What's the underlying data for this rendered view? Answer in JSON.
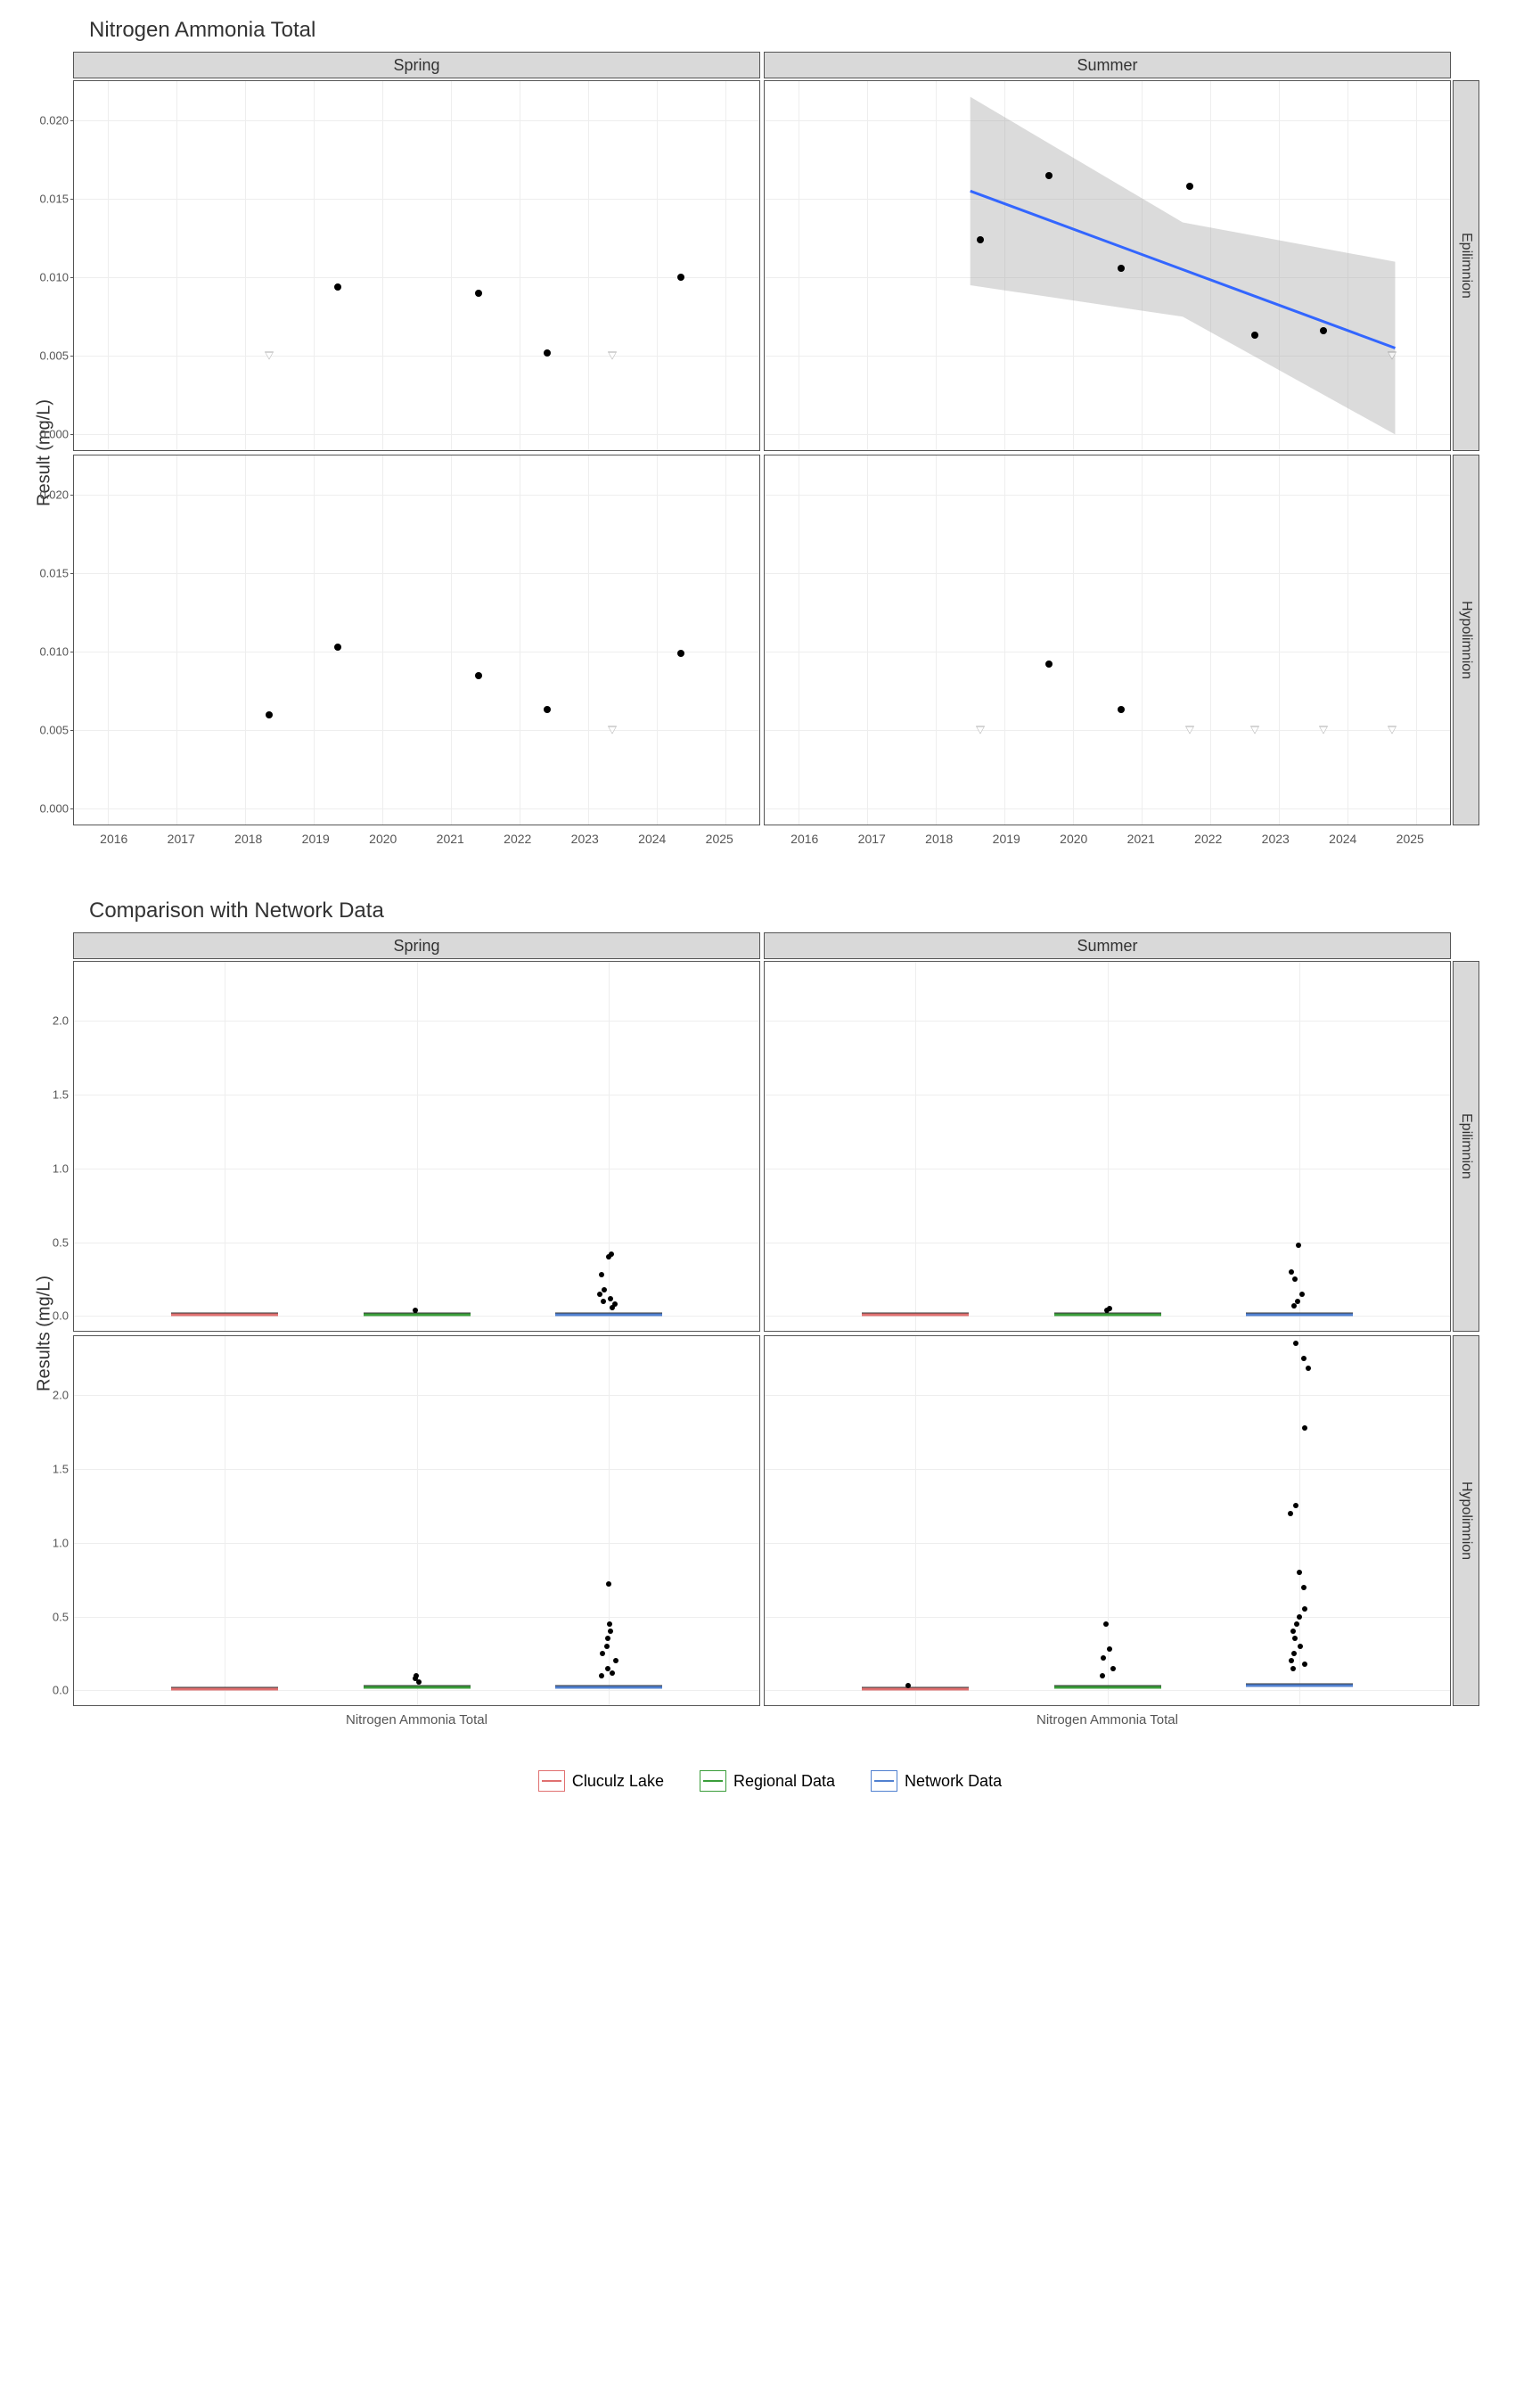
{
  "chart_data": [
    {
      "type": "scatter",
      "title": "Nitrogen Ammonia Total",
      "ylabel": "Result (mg/L)",
      "xlabel": "",
      "x_ticks": [
        "2016",
        "2017",
        "2018",
        "2019",
        "2020",
        "2021",
        "2022",
        "2023",
        "2024",
        "2025"
      ],
      "y_ticks": [
        "0.000",
        "0.005",
        "0.010",
        "0.015",
        "0.020"
      ],
      "xlim": [
        2015.5,
        2025.5
      ],
      "ylim": [
        -0.001,
        0.0225
      ],
      "col_facets": [
        "Spring",
        "Summer"
      ],
      "row_facets": [
        "Epilimnion",
        "Hypolimnion"
      ],
      "panels": {
        "Spring_Epilimnion": {
          "points": [
            {
              "x": 2018.35,
              "y": 0.005,
              "shape": "triangle"
            },
            {
              "x": 2019.35,
              "y": 0.0094,
              "shape": "dot"
            },
            {
              "x": 2021.4,
              "y": 0.009,
              "shape": "dot"
            },
            {
              "x": 2022.4,
              "y": 0.0052,
              "shape": "dot"
            },
            {
              "x": 2023.35,
              "y": 0.005,
              "shape": "triangle"
            },
            {
              "x": 2024.35,
              "y": 0.01,
              "shape": "dot"
            }
          ]
        },
        "Summer_Epilimnion": {
          "points": [
            {
              "x": 2018.65,
              "y": 0.0124,
              "shape": "dot"
            },
            {
              "x": 2019.65,
              "y": 0.0165,
              "shape": "dot"
            },
            {
              "x": 2020.7,
              "y": 0.0106,
              "shape": "dot"
            },
            {
              "x": 2021.7,
              "y": 0.0158,
              "shape": "dot"
            },
            {
              "x": 2022.65,
              "y": 0.0063,
              "shape": "dot"
            },
            {
              "x": 2023.65,
              "y": 0.0066,
              "shape": "dot"
            },
            {
              "x": 2024.65,
              "y": 0.005,
              "shape": "triangle"
            }
          ],
          "trend": {
            "x1": 2018.5,
            "y1": 0.0155,
            "x2": 2024.7,
            "y2": 0.0055
          },
          "ci": [
            {
              "x": 2018.5,
              "lo": 0.0095,
              "hi": 0.0215
            },
            {
              "x": 2021.6,
              "lo": 0.0075,
              "hi": 0.0135
            },
            {
              "x": 2024.7,
              "lo": 0.0,
              "hi": 0.011
            }
          ]
        },
        "Spring_Hypolimnion": {
          "points": [
            {
              "x": 2018.35,
              "y": 0.006,
              "shape": "dot"
            },
            {
              "x": 2019.35,
              "y": 0.0103,
              "shape": "dot"
            },
            {
              "x": 2021.4,
              "y": 0.0085,
              "shape": "dot"
            },
            {
              "x": 2022.4,
              "y": 0.0063,
              "shape": "dot"
            },
            {
              "x": 2023.35,
              "y": 0.005,
              "shape": "triangle"
            },
            {
              "x": 2024.35,
              "y": 0.0099,
              "shape": "dot"
            }
          ]
        },
        "Summer_Hypolimnion": {
          "points": [
            {
              "x": 2018.65,
              "y": 0.005,
              "shape": "triangle"
            },
            {
              "x": 2019.65,
              "y": 0.0092,
              "shape": "dot"
            },
            {
              "x": 2020.7,
              "y": 0.0063,
              "shape": "dot"
            },
            {
              "x": 2021.7,
              "y": 0.005,
              "shape": "triangle"
            },
            {
              "x": 2022.65,
              "y": 0.005,
              "shape": "triangle"
            },
            {
              "x": 2023.65,
              "y": 0.005,
              "shape": "triangle"
            },
            {
              "x": 2024.65,
              "y": 0.005,
              "shape": "triangle"
            }
          ]
        }
      }
    },
    {
      "type": "boxplot",
      "title": "Comparison with Network Data",
      "ylabel": "Results (mg/L)",
      "xlabel": "",
      "x_category": "Nitrogen Ammonia Total",
      "y_ticks": [
        "0.0",
        "0.5",
        "1.0",
        "1.5",
        "2.0"
      ],
      "ylim": [
        -0.1,
        2.4
      ],
      "col_facets": [
        "Spring",
        "Summer"
      ],
      "row_facets": [
        "Epilimnion",
        "Hypolimnion"
      ],
      "groups": [
        "Cluculz Lake",
        "Regional Data",
        "Network Data"
      ],
      "colors": {
        "Cluculz Lake": "#e07070",
        "Regional Data": "#3a9d3a",
        "Network Data": "#5080d0"
      },
      "panels": {
        "Spring_Epilimnion": {
          "boxes": [
            {
              "g": "Cluculz Lake",
              "med": 0.01
            },
            {
              "g": "Regional Data",
              "med": 0.01
            },
            {
              "g": "Network Data",
              "med": 0.01
            }
          ],
          "outliers": [
            {
              "g": "Regional Data",
              "y": 0.04
            },
            {
              "g": "Network Data",
              "y": 0.42
            },
            {
              "g": "Network Data",
              "y": 0.4
            },
            {
              "g": "Network Data",
              "y": 0.28
            },
            {
              "g": "Network Data",
              "y": 0.18
            },
            {
              "g": "Network Data",
              "y": 0.15
            },
            {
              "g": "Network Data",
              "y": 0.12
            },
            {
              "g": "Network Data",
              "y": 0.1
            },
            {
              "g": "Network Data",
              "y": 0.08
            },
            {
              "g": "Network Data",
              "y": 0.06
            }
          ]
        },
        "Summer_Epilimnion": {
          "boxes": [
            {
              "g": "Cluculz Lake",
              "med": 0.01
            },
            {
              "g": "Regional Data",
              "med": 0.01
            },
            {
              "g": "Network Data",
              "med": 0.01
            }
          ],
          "outliers": [
            {
              "g": "Regional Data",
              "y": 0.05
            },
            {
              "g": "Regional Data",
              "y": 0.04
            },
            {
              "g": "Network Data",
              "y": 0.48
            },
            {
              "g": "Network Data",
              "y": 0.3
            },
            {
              "g": "Network Data",
              "y": 0.25
            },
            {
              "g": "Network Data",
              "y": 0.15
            },
            {
              "g": "Network Data",
              "y": 0.1
            },
            {
              "g": "Network Data",
              "y": 0.07
            }
          ]
        },
        "Spring_Hypolimnion": {
          "boxes": [
            {
              "g": "Cluculz Lake",
              "med": 0.01
            },
            {
              "g": "Regional Data",
              "med": 0.02
            },
            {
              "g": "Network Data",
              "med": 0.02
            }
          ],
          "outliers": [
            {
              "g": "Regional Data",
              "y": 0.1
            },
            {
              "g": "Regional Data",
              "y": 0.08
            },
            {
              "g": "Regional Data",
              "y": 0.06
            },
            {
              "g": "Network Data",
              "y": 0.72
            },
            {
              "g": "Network Data",
              "y": 0.45
            },
            {
              "g": "Network Data",
              "y": 0.4
            },
            {
              "g": "Network Data",
              "y": 0.35
            },
            {
              "g": "Network Data",
              "y": 0.3
            },
            {
              "g": "Network Data",
              "y": 0.25
            },
            {
              "g": "Network Data",
              "y": 0.2
            },
            {
              "g": "Network Data",
              "y": 0.15
            },
            {
              "g": "Network Data",
              "y": 0.12
            },
            {
              "g": "Network Data",
              "y": 0.1
            }
          ]
        },
        "Summer_Hypolimnion": {
          "boxes": [
            {
              "g": "Cluculz Lake",
              "med": 0.01
            },
            {
              "g": "Regional Data",
              "med": 0.02
            },
            {
              "g": "Network Data",
              "med": 0.03
            }
          ],
          "outliers": [
            {
              "g": "Cluculz Lake",
              "y": 0.03
            },
            {
              "g": "Regional Data",
              "y": 0.45
            },
            {
              "g": "Regional Data",
              "y": 0.28
            },
            {
              "g": "Regional Data",
              "y": 0.22
            },
            {
              "g": "Regional Data",
              "y": 0.15
            },
            {
              "g": "Regional Data",
              "y": 0.1
            },
            {
              "g": "Network Data",
              "y": 2.35
            },
            {
              "g": "Network Data",
              "y": 2.25
            },
            {
              "g": "Network Data",
              "y": 2.18
            },
            {
              "g": "Network Data",
              "y": 1.78
            },
            {
              "g": "Network Data",
              "y": 1.25
            },
            {
              "g": "Network Data",
              "y": 1.2
            },
            {
              "g": "Network Data",
              "y": 0.8
            },
            {
              "g": "Network Data",
              "y": 0.7
            },
            {
              "g": "Network Data",
              "y": 0.55
            },
            {
              "g": "Network Data",
              "y": 0.5
            },
            {
              "g": "Network Data",
              "y": 0.45
            },
            {
              "g": "Network Data",
              "y": 0.4
            },
            {
              "g": "Network Data",
              "y": 0.35
            },
            {
              "g": "Network Data",
              "y": 0.3
            },
            {
              "g": "Network Data",
              "y": 0.25
            },
            {
              "g": "Network Data",
              "y": 0.2
            },
            {
              "g": "Network Data",
              "y": 0.18
            },
            {
              "g": "Network Data",
              "y": 0.15
            }
          ]
        }
      }
    }
  ],
  "legend": {
    "items": [
      "Cluculz Lake",
      "Regional Data",
      "Network Data"
    ]
  }
}
